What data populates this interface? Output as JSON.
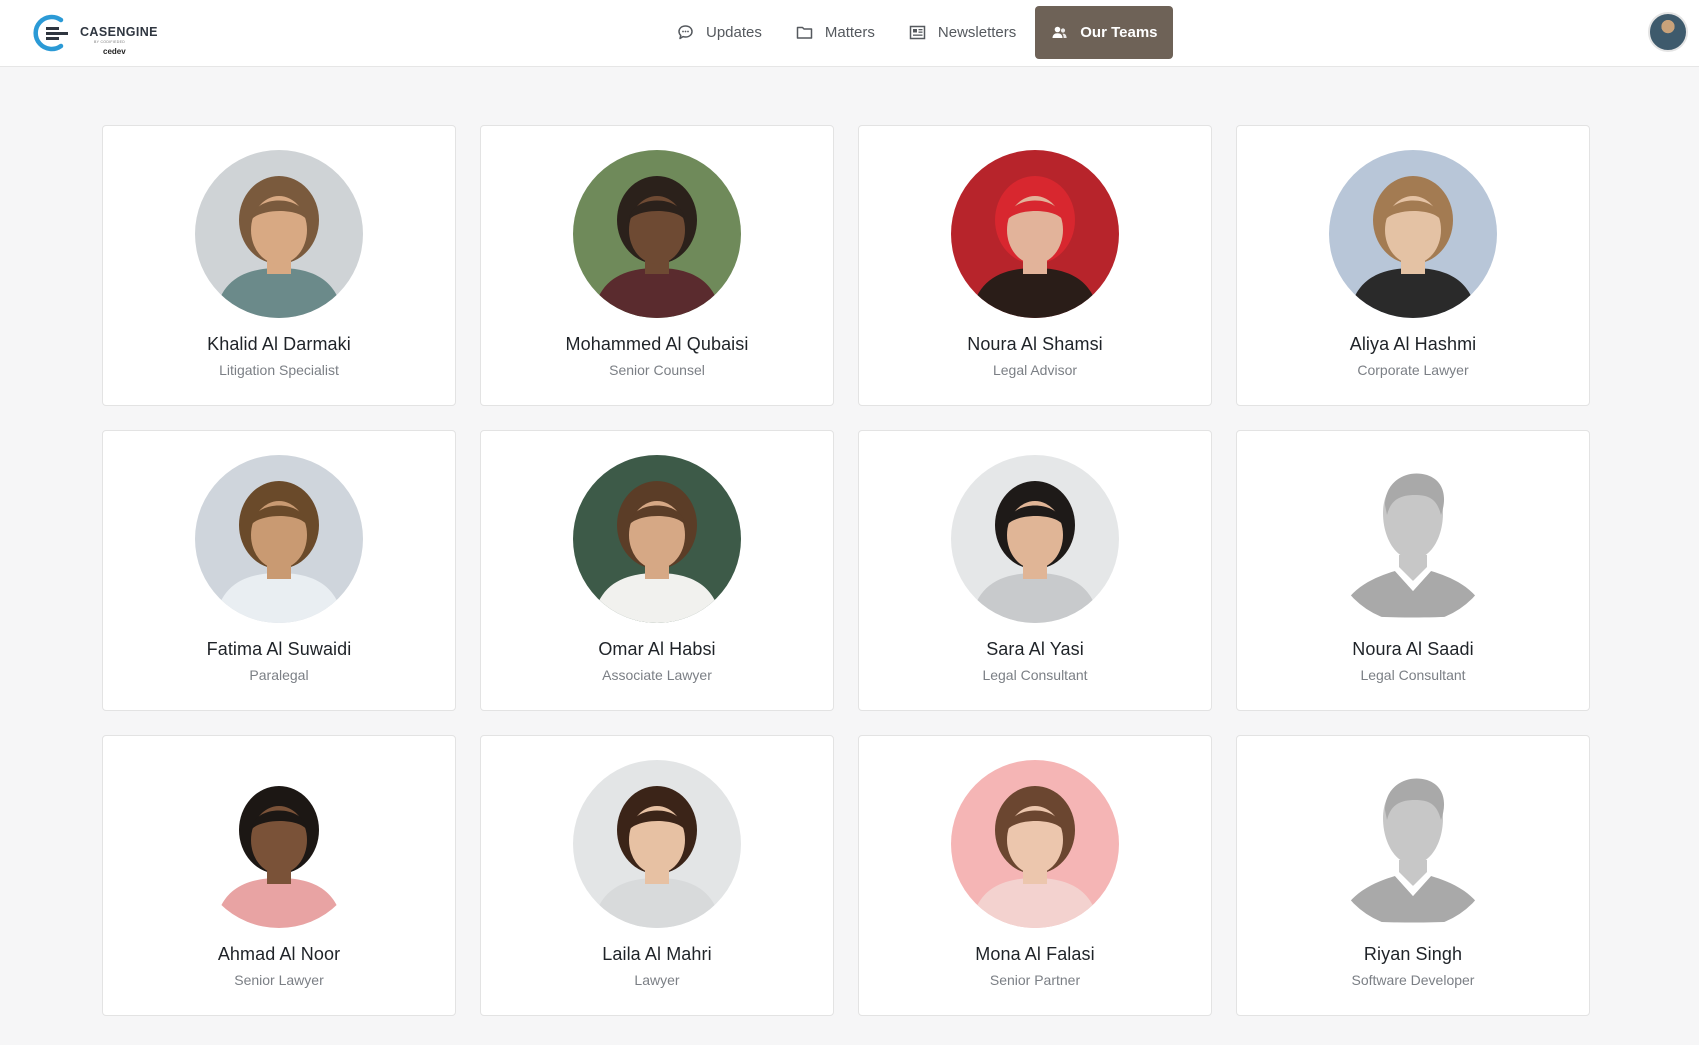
{
  "brand": {
    "name": "CASENGINE",
    "tagline": "BY CODIFIEDED",
    "workspace": "cedev"
  },
  "nav": [
    {
      "label": "Updates",
      "icon": "chat-bubble-icon",
      "active": false
    },
    {
      "label": "Matters",
      "icon": "folder-icon",
      "active": false
    },
    {
      "label": "Newsletters",
      "icon": "newspaper-icon",
      "active": false
    },
    {
      "label": "Our Teams",
      "icon": "team-icon",
      "active": true
    }
  ],
  "colors": {
    "accent": "#6e6257",
    "background": "#f6f6f7",
    "card": "#ffffff",
    "name_text": "#1f2328",
    "role_text": "#7b7f85"
  },
  "team": [
    {
      "name": "Khalid Al Darmaki",
      "role": "Litigation Specialist",
      "photo": "photo"
    },
    {
      "name": "Mohammed Al Qubaisi",
      "role": "Senior Counsel",
      "photo": "photo"
    },
    {
      "name": "Noura Al Shamsi",
      "role": "Legal Advisor",
      "photo": "photo"
    },
    {
      "name": "Aliya Al Hashmi",
      "role": "Corporate Lawyer",
      "photo": "photo"
    },
    {
      "name": "Fatima Al Suwaidi",
      "role": "Paralegal",
      "photo": "photo"
    },
    {
      "name": "Omar Al Habsi",
      "role": "Associate Lawyer",
      "photo": "photo"
    },
    {
      "name": "Sara Al Yasi",
      "role": "Legal Consultant",
      "photo": "photo"
    },
    {
      "name": "Noura Al Saadi",
      "role": "Legal Consultant",
      "photo": "placeholder"
    },
    {
      "name": "Ahmad Al Noor",
      "role": "Senior Lawyer",
      "photo": "photo"
    },
    {
      "name": "Laila Al Mahri",
      "role": "Lawyer",
      "photo": "photo"
    },
    {
      "name": "Mona Al Falasi",
      "role": "Senior Partner",
      "photo": "photo"
    },
    {
      "name": "Riyan Singh",
      "role": "Software Developer",
      "photo": "placeholder"
    }
  ]
}
